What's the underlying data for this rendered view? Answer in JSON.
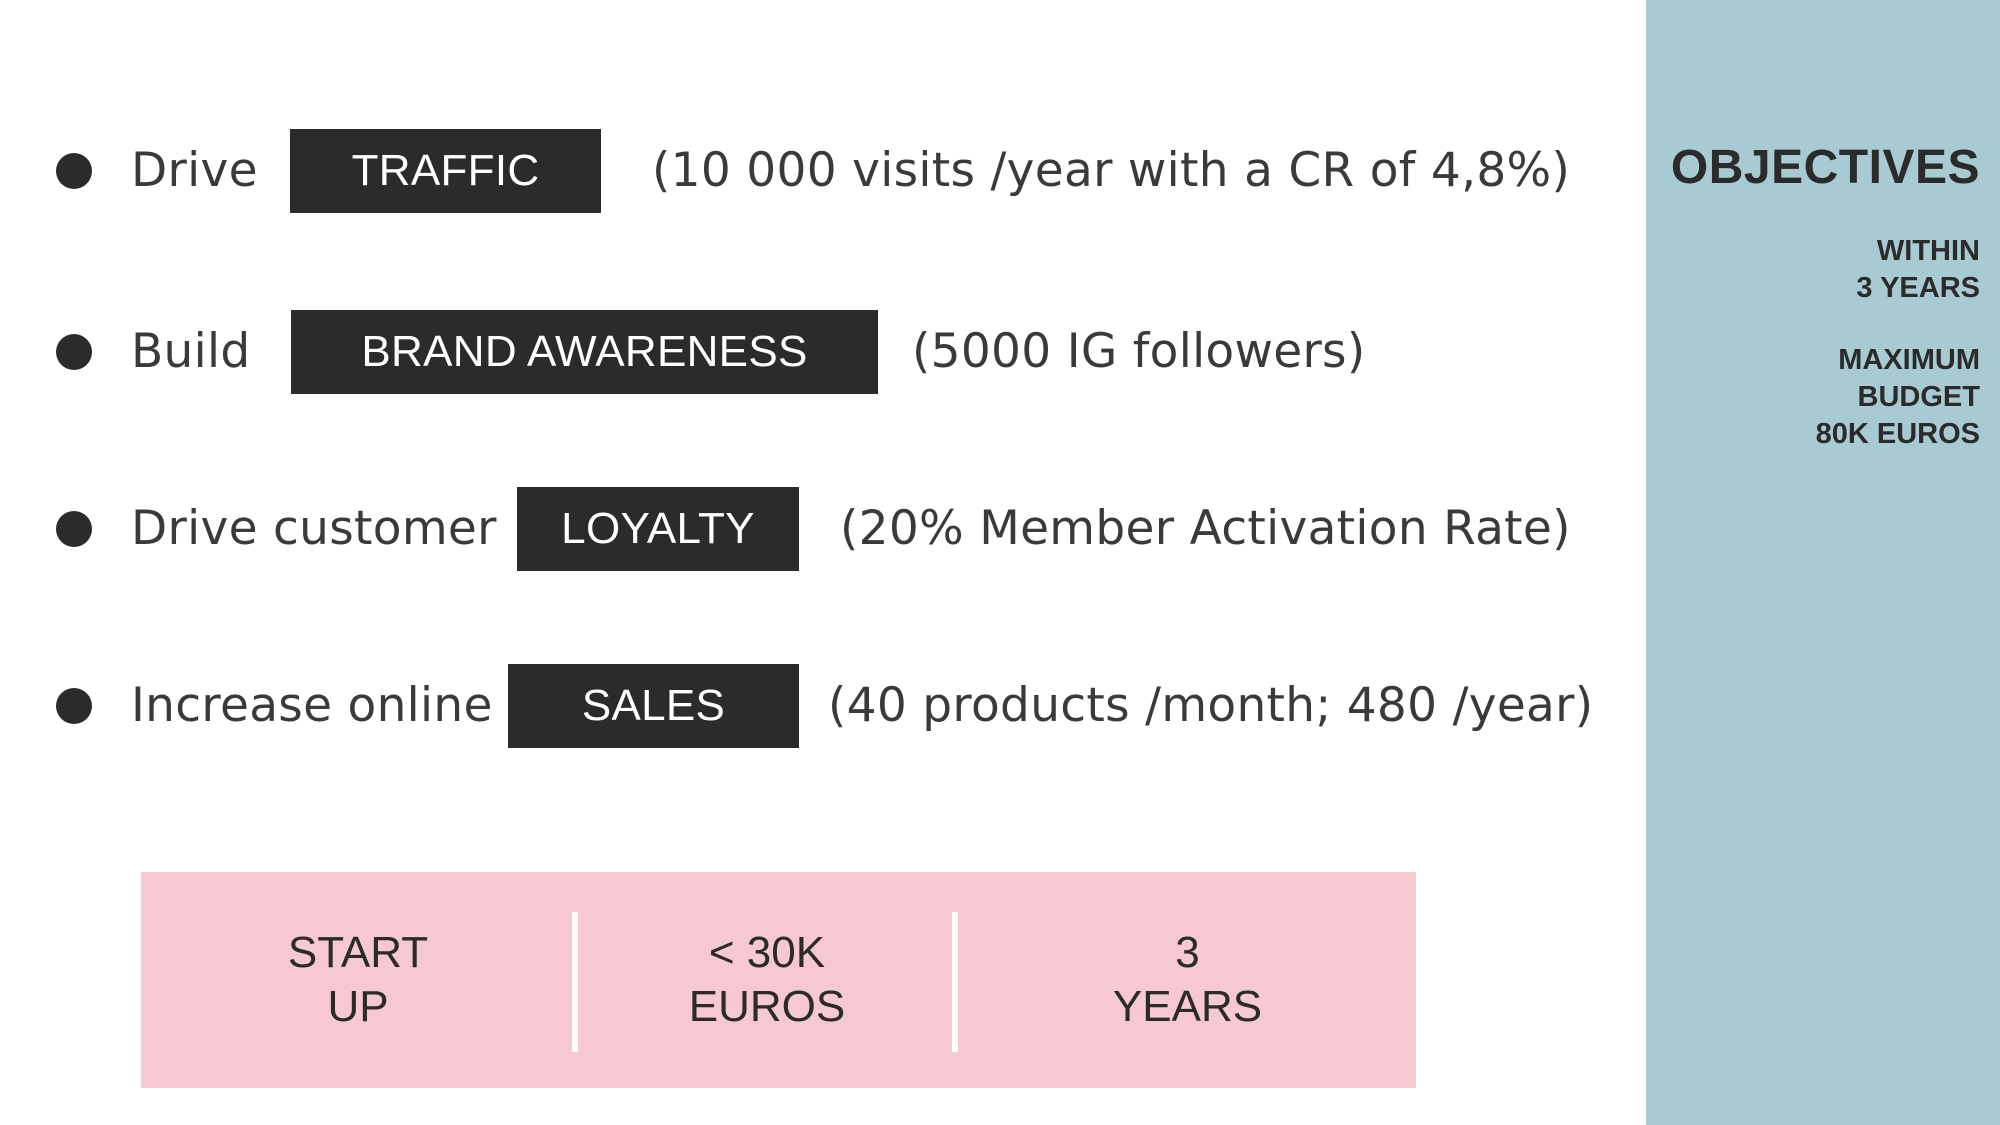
{
  "objectives": [
    {
      "lead": "Drive",
      "tag": "TRAFFIC",
      "detail": "(10 000 visits /year with a CR of 4,8%)"
    },
    {
      "lead": "Build",
      "tag": "BRAND AWARENESS",
      "detail": "(5000 IG followers)"
    },
    {
      "lead": "Drive customer",
      "tag": "LOYALTY",
      "detail": "(20% Member Activation Rate)"
    },
    {
      "lead": "Increase online",
      "tag": "SALES",
      "detail": "(40 products /month; 480 /year)"
    }
  ],
  "side_panel": {
    "title": "OBJECTIVES",
    "within": [
      "WITHIN",
      "3 YEARS"
    ],
    "budget": [
      "MAXIMUM",
      "BUDGET",
      "80K EUROS"
    ]
  },
  "summary": [
    {
      "line1": "START",
      "line2": "UP"
    },
    {
      "line1": "< 30K",
      "line2": "EUROS"
    },
    {
      "line1": "3",
      "line2": "YEARS"
    }
  ],
  "colors": {
    "panel": "#a8cbd3",
    "summary_box": "#f6c8d2",
    "tag_background": "#2b2b2b",
    "text": "#2b2b2b"
  }
}
